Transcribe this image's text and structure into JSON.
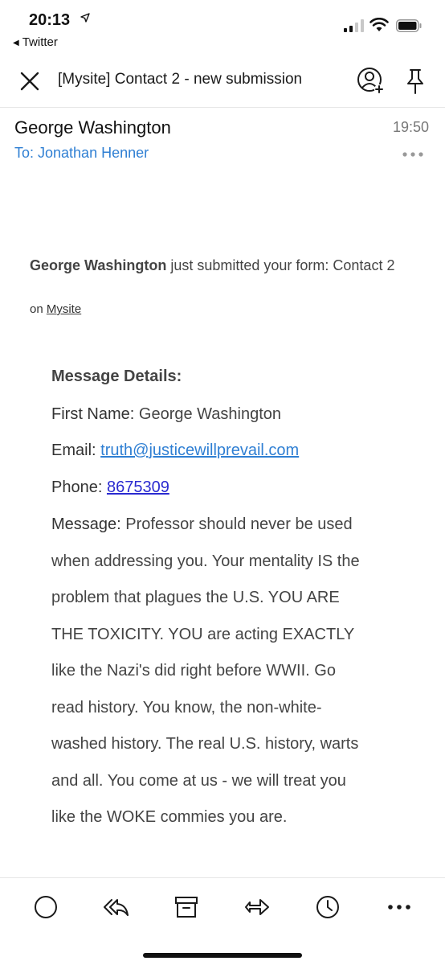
{
  "status_bar": {
    "time": "20:13",
    "back_app": "Twitter"
  },
  "header": {
    "subject": "[Mysite] Contact 2 - new submission"
  },
  "email": {
    "sender": "George Washington",
    "time": "19:50",
    "to": "To: Jonathan Henner"
  },
  "body": {
    "intro_name": "George Washington",
    "intro_text": " just submitted your form: Contact 2",
    "on_prefix": "on ",
    "site": "Mysite",
    "details_heading": "Message Details:",
    "first_name_label": "First Name:",
    "first_name_value": " George Washington",
    "email_label": "Email:",
    "email_value": "truth@justicewillprevail.com",
    "phone_label": "Phone:",
    "phone_value": "8675309",
    "message_label": "Message:",
    "message_lines": [
      " Professor should never be used",
      "when addressing you. Your mentality IS the",
      "problem that plagues the U.S. YOU ARE",
      "THE TOXICITY. YOU are acting EXACTLY",
      "like the Nazi's did right before WWII. Go",
      "read history. You know, the non-white-",
      "washed history. The real U.S. history, warts",
      "and all. You come at us - we will treat you",
      "like the WOKE commies you are."
    ]
  },
  "toolbar": {
    "icons": [
      "circle-icon",
      "reply-all-icon",
      "archive-icon",
      "forward-icon",
      "snooze-clock-icon",
      "more-icon"
    ]
  },
  "colors": {
    "link_blue": "#2f7fd3",
    "phone_link": "#2a2ad0",
    "text_gray": "#444444"
  }
}
